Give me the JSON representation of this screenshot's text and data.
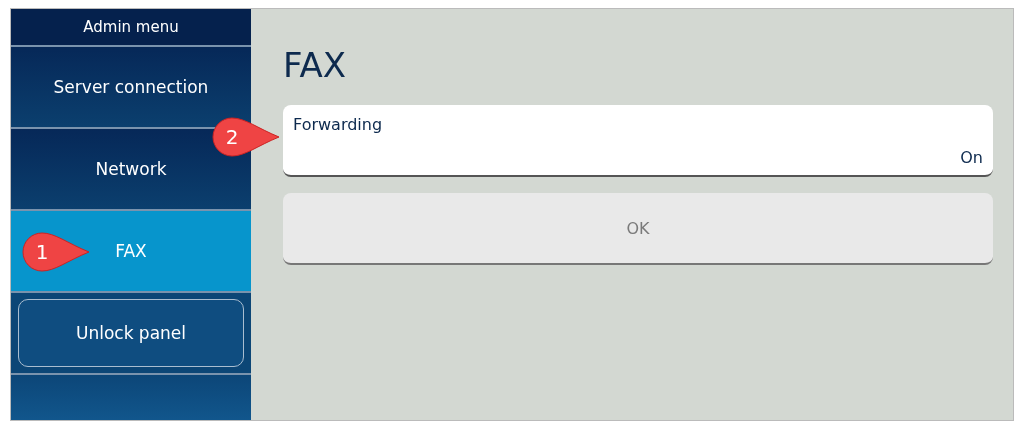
{
  "sidebar": {
    "title": "Admin menu",
    "items": [
      {
        "label": "Server connection",
        "kind": "item",
        "selected": false
      },
      {
        "label": "Network",
        "kind": "item",
        "selected": false
      },
      {
        "label": "FAX",
        "kind": "item",
        "selected": true
      },
      {
        "label": "Unlock panel",
        "kind": "button",
        "selected": false
      },
      {
        "kind": "item",
        "selected": false
      }
    ]
  },
  "page": {
    "title": "FAX",
    "setting": {
      "label": "Forwarding",
      "value": "On"
    },
    "ok_button": {
      "label": "OK",
      "disabled": true
    }
  },
  "callouts": [
    {
      "number": "1"
    },
    {
      "number": "2"
    }
  ]
}
